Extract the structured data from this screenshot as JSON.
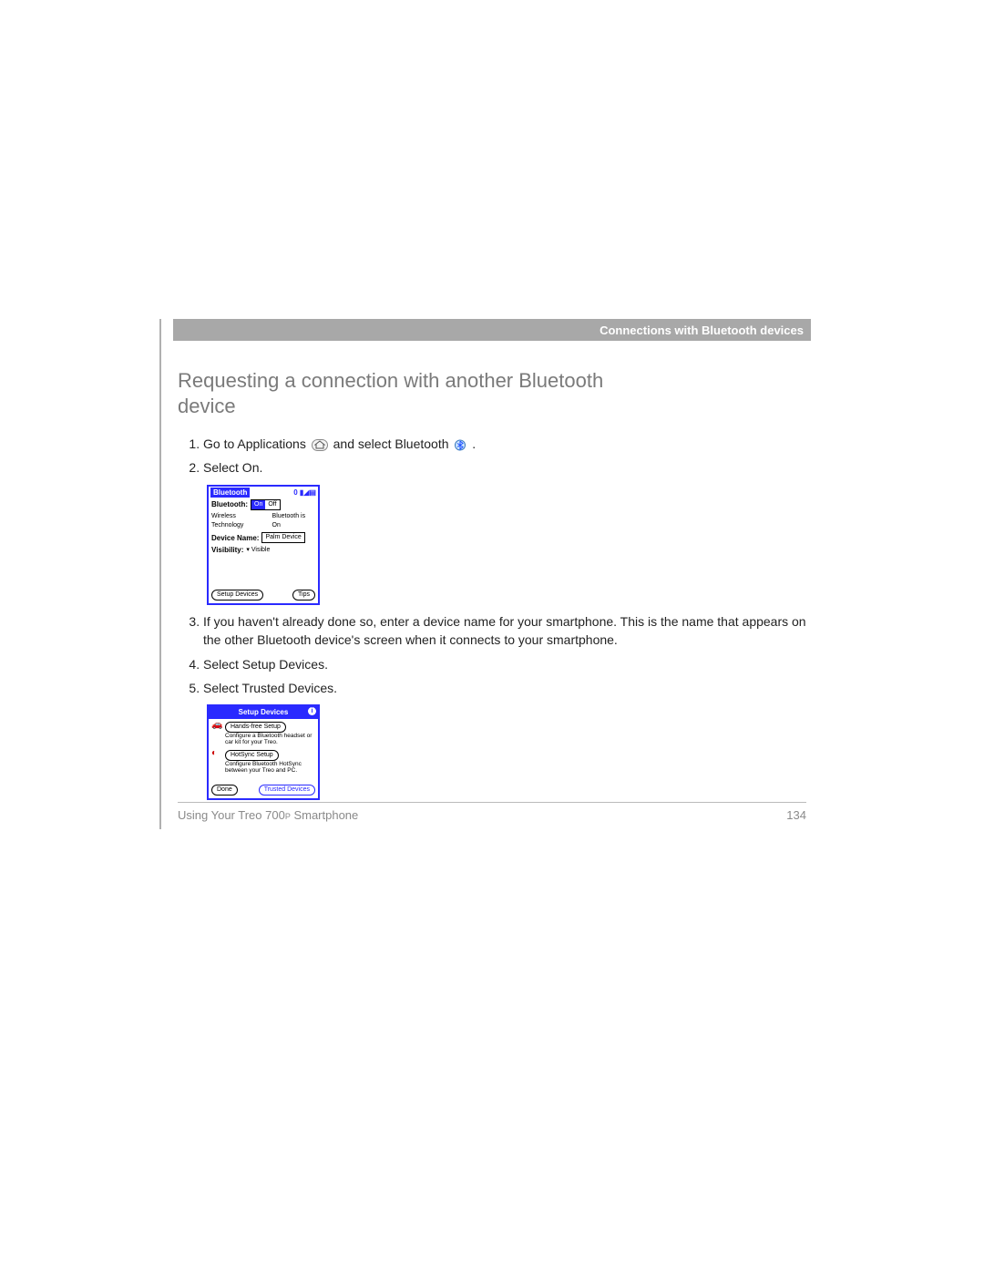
{
  "header": {
    "section": "Connections with Bluetooth devices"
  },
  "title": "Requesting a connection with another Bluetooth device",
  "steps": {
    "s1a": "Go to Applications ",
    "s1b": " and select Bluetooth ",
    "s1c": " .",
    "s2": "Select On.",
    "s3": "If you haven't already done so, enter a device name for your smartphone. This is the name that appears on the other Bluetooth device's screen when it connects to your smartphone.",
    "s4": "Select Setup Devices.",
    "s5": "Select Trusted Devices."
  },
  "shot1": {
    "title": "Bluetooth",
    "status_icons": "0 ▮◢▤",
    "row1_label": "Bluetooth:",
    "on": "On",
    "off": "Off",
    "row1_sub_label": "Wireless Technology",
    "row1_sub_value": "Bluetooth is On",
    "row2_label": "Device Name:",
    "row2_value": "Palm Device",
    "row3_label": "Visibility:",
    "row3_value": "▾ Visible",
    "btn_left": "Setup Devices",
    "btn_right": "Tips"
  },
  "shot2": {
    "title": "Setup Devices",
    "info": "i",
    "e1_btn": "Hands-free Setup",
    "e1_desc": "Configure a Bluetooth headset or car kit for your Treo.",
    "e2_btn": "HotSync Setup",
    "e2_desc": "Configure Bluetooth HotSync between your Treo and PC.",
    "btn_done": "Done",
    "btn_trusted": "Trusted Devices"
  },
  "footer": {
    "left_a": "Using Your Treo 700",
    "left_sub": "P",
    "left_b": " Smartphone",
    "page": "134"
  }
}
